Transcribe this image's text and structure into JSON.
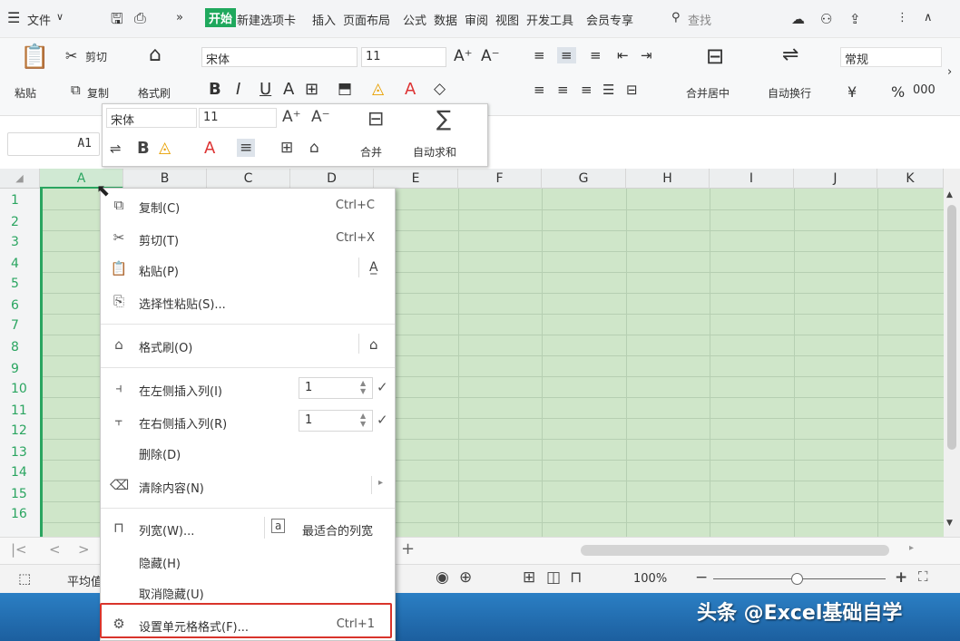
{
  "menubar": {
    "file_label": "文件",
    "tab_start": "开始",
    "tabs": [
      "新建选项卡",
      "插入",
      "页面布局",
      "公式",
      "数据",
      "审阅",
      "视图",
      "开发工具",
      "会员专享"
    ],
    "search_label": "查找"
  },
  "ribbon": {
    "paste_label": "粘贴",
    "cut_label": "剪切",
    "copy_label": "复制",
    "format_painter_label": "格式刷",
    "font_name": "宋体",
    "font_size": "11",
    "merge_center_label": "合并居中",
    "wrap_label": "自动换行",
    "number_format": "常规",
    "currency_symbol": "¥",
    "percent_symbol": "%"
  },
  "formula_bar": {
    "name_box": "A1"
  },
  "mini_toolbar": {
    "font_name": "宋体",
    "font_size": "11",
    "merge_label": "合并",
    "autosum_label": "自动求和"
  },
  "columns": [
    "A",
    "B",
    "C",
    "D",
    "E",
    "F",
    "G",
    "H",
    "I",
    "J",
    "K"
  ],
  "rows": [
    "1",
    "2",
    "3",
    "4",
    "5",
    "6",
    "7",
    "8",
    "9",
    "10",
    "11",
    "12",
    "13",
    "14",
    "15",
    "16"
  ],
  "context_menu": {
    "copy": {
      "label": "复制(C)",
      "shortcut": "Ctrl+C"
    },
    "cut": {
      "label": "剪切(T)",
      "shortcut": "Ctrl+X"
    },
    "paste": {
      "label": "粘贴(P)"
    },
    "paste_special": {
      "label": "选择性粘贴(S)..."
    },
    "format_painter": {
      "label": "格式刷(O)"
    },
    "insert_left": {
      "label": "在左侧插入列(I)",
      "value": "1"
    },
    "insert_right": {
      "label": "在右侧插入列(R)",
      "value": "1"
    },
    "delete": {
      "label": "删除(D)"
    },
    "clear": {
      "label": "清除内容(N)"
    },
    "col_width": {
      "label": "列宽(W)..."
    },
    "best_fit": {
      "label": "最适合的列宽"
    },
    "hide": {
      "label": "隐藏(H)"
    },
    "unhide": {
      "label": "取消隐藏(U)"
    },
    "format_cells": {
      "label": "设置单元格格式(F)...",
      "shortcut": "Ctrl+1"
    }
  },
  "status_bar": {
    "average_label": "平均值",
    "zoom": "100%"
  },
  "watermark": "头条 @Excel基础自学",
  "colors": {
    "accent": "#1fa85d",
    "selection_fill": "#cfe6c9",
    "highlight_border": "#d9342b",
    "row_number": "#2aa560"
  }
}
